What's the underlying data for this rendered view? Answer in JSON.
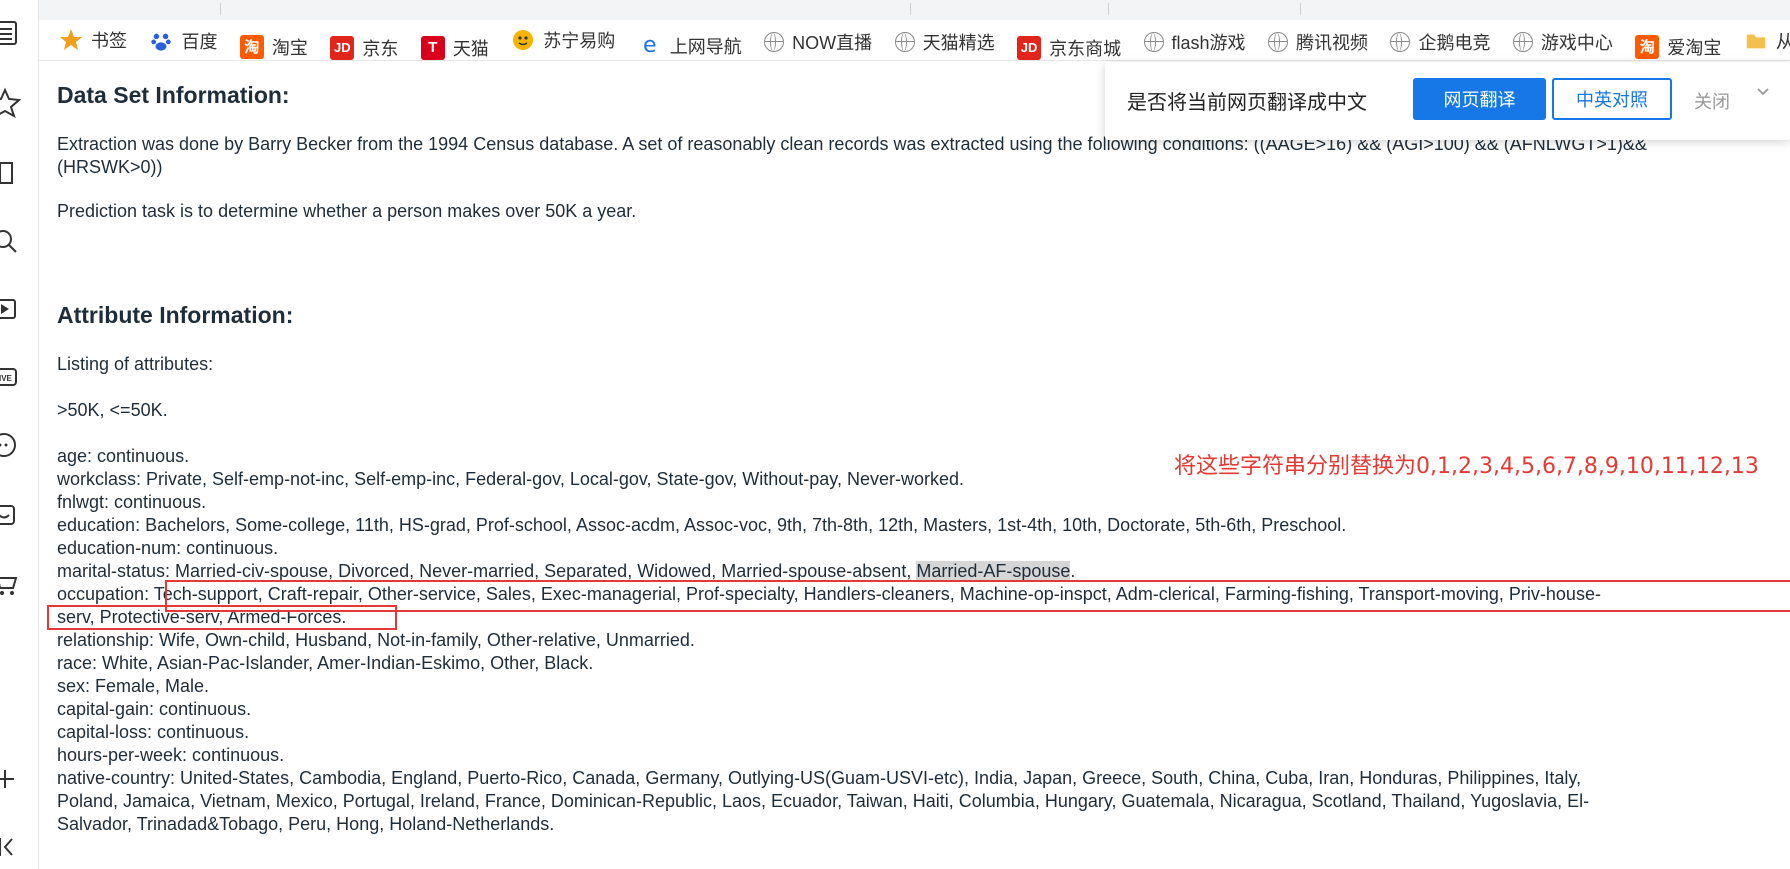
{
  "sidebar": {
    "icons": [
      "list-icon",
      "star-icon",
      "book-icon",
      "search-icon",
      "video-icon",
      "live-icon",
      "chat-icon",
      "bag-icon",
      "cart-icon",
      "add-icon",
      "collapse-icon"
    ]
  },
  "bookmarks": [
    {
      "label": "书签",
      "icon": "star",
      "color": "#f0a01c"
    },
    {
      "label": "百度",
      "icon": "baidu",
      "color": "#2b5fe0"
    },
    {
      "label": "淘宝",
      "icon": "淘",
      "color": "#ff5a00"
    },
    {
      "label": "京东",
      "icon": "JD",
      "color": "#e1251b"
    },
    {
      "label": "天猫",
      "icon": "T",
      "color": "#d8001a"
    },
    {
      "label": "苏宁易购",
      "icon": "suning",
      "color": "#f5b400"
    },
    {
      "label": "上网导航",
      "icon": "e",
      "color": "#1a73e8"
    },
    {
      "label": "NOW直播",
      "icon": "globe",
      "color": "#8a8a8a"
    },
    {
      "label": "天猫精选",
      "icon": "globe",
      "color": "#8a8a8a"
    },
    {
      "label": "京东商城",
      "icon": "JD",
      "color": "#e1251b"
    },
    {
      "label": "flash游戏",
      "icon": "globe",
      "color": "#8a8a8a"
    },
    {
      "label": "腾讯视频",
      "icon": "globe",
      "color": "#8a8a8a"
    },
    {
      "label": "企鹅电竞",
      "icon": "globe",
      "color": "#8a8a8a"
    },
    {
      "label": "游戏中心",
      "icon": "globe",
      "color": "#8a8a8a"
    },
    {
      "label": "爱淘宝",
      "icon": "淘",
      "color": "#ff5a00"
    },
    {
      "label": "从",
      "icon": "folder",
      "color": "#f3c14b"
    }
  ],
  "translate_bar": {
    "question": "是否将当前网页翻译成中文",
    "translate_button": "网页翻译",
    "bilingual_button": "中英对照",
    "close_button": "关闭"
  },
  "content": {
    "h_dataset": "Data Set Information:",
    "extraction": "Extraction was done by Barry Becker from the 1994 Census database. A set of reasonably clean records was extracted using the following conditions: ((AAGE>16) && (AGI>100) && (AFNLWGT>1)&& (HRSWK>0))",
    "prediction": "Prediction task is to determine whether a person makes over 50K a year.",
    "h_attr": "Attribute Information:",
    "listing": "Listing of attributes:",
    "classes": ">50K, <=50K.",
    "age": "age: continuous.",
    "workclass": "workclass: Private, Self-emp-not-inc, Self-emp-inc, Federal-gov, Local-gov, State-gov, Without-pay, Never-worked.",
    "fnlwgt": "fnlwgt: continuous.",
    "education": "education: Bachelors, Some-college, 11th, HS-grad, Prof-school, Assoc-acdm, Assoc-voc, 9th, 7th-8th, 12th, Masters, 1st-4th, 10th, Doctorate, 5th-6th, Preschool.",
    "education_num": "education-num: continuous.",
    "marital_prefix": "marital-status: Married-civ-spouse, Divorced, Never-married, Separated, Widowed, Married-spouse-absent, ",
    "marital_highlight": "Married-AF-spouse",
    "marital_suffix": ".",
    "occupation_prefix": "occupation: ",
    "occupation_line1": "Tech-support, Craft-repair, Other-service, Sales, Exec-managerial, Prof-specialty, Handlers-cleaners, Machine-op-inspct, Adm-clerical, Farming-fishing, Transport-moving, Priv-house-",
    "occupation_line2": "serv, Protective-serv, Armed-Forces.",
    "relationship": "relationship: Wife, Own-child, Husband, Not-in-family, Other-relative, Unmarried.",
    "race": "race: White, Asian-Pac-Islander, Amer-Indian-Eskimo, Other, Black.",
    "sex": "sex: Female, Male.",
    "capital_gain": "capital-gain: continuous.",
    "capital_loss": "capital-loss: continuous.",
    "hours": "hours-per-week: continuous.",
    "native_line1": "native-country: United-States, Cambodia, England, Puerto-Rico, Canada, Germany, Outlying-US(Guam-USVI-etc), India, Japan, Greece, South, China, Cuba, Iran, Honduras, Philippines, Italy,",
    "native_line2": "Poland, Jamaica, Vietnam, Mexico, Portugal, Ireland, France, Dominican-Republic, Laos, Ecuador, Taiwan, Haiti, Columbia, Hungary, Guatemala, Nicaragua, Scotland, Thailand, Yugoslavia, El-",
    "native_line3": "Salvador, Trinadad&Tobago, Peru, Hong, Holand-Netherlands."
  },
  "annotation": "将这些字符串分别替换为0,1,2,3,4,5,6,7,8,9,10,11,12,13"
}
